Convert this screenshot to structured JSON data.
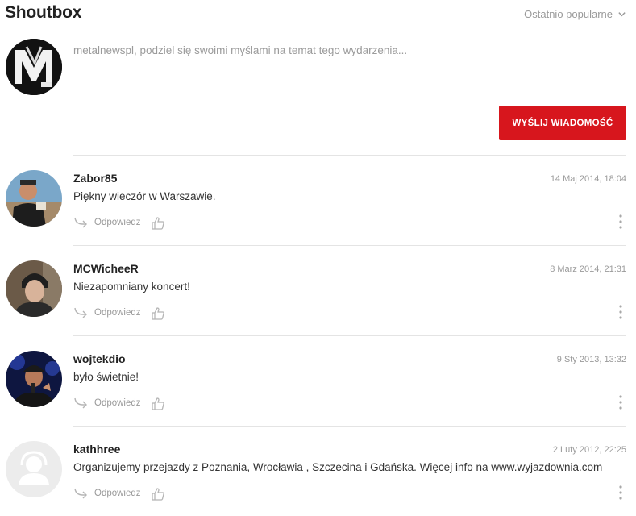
{
  "header": {
    "title": "Shoutbox",
    "sort_label": "Ostatnio popularne"
  },
  "composer": {
    "placeholder": "metalnewspl, podziel się swoimi myślami na temat tego wydarzenia...",
    "send_label": "WYŚLIJ WIADOMOŚĆ"
  },
  "comments": [
    {
      "user": "Zabor85",
      "date": "14 Maj 2014, 18:04",
      "text": "Piękny wieczór w Warszawie.",
      "reply_label": "Odpowiedz"
    },
    {
      "user": "MCWicheeR",
      "date": "8 Marz 2014, 21:31",
      "text": "Niezapomniany koncert!",
      "reply_label": "Odpowiedz"
    },
    {
      "user": "wojtekdio",
      "date": "9 Sty 2013, 13:32",
      "text": "było świetnie!",
      "reply_label": "Odpowiedz"
    },
    {
      "user": "kathhree",
      "date": "2 Luty 2012, 22:25",
      "text": "Organizujemy przejazdy z Poznania, Wrocławia , Szczecina i Gdańska. Więcej info na www.wyjazdownia.com",
      "reply_label": "Odpowiedz"
    }
  ],
  "colors": {
    "accent": "#d7161d",
    "muted": "#9a9a9a",
    "divider": "#e4e4e4"
  },
  "icons": {
    "sort": "chevron-down-icon",
    "reply": "reply-arrow-icon",
    "like": "thumbs-up-icon",
    "more": "more-vertical-icon",
    "placeholder_avatar": "user-placeholder-icon"
  }
}
